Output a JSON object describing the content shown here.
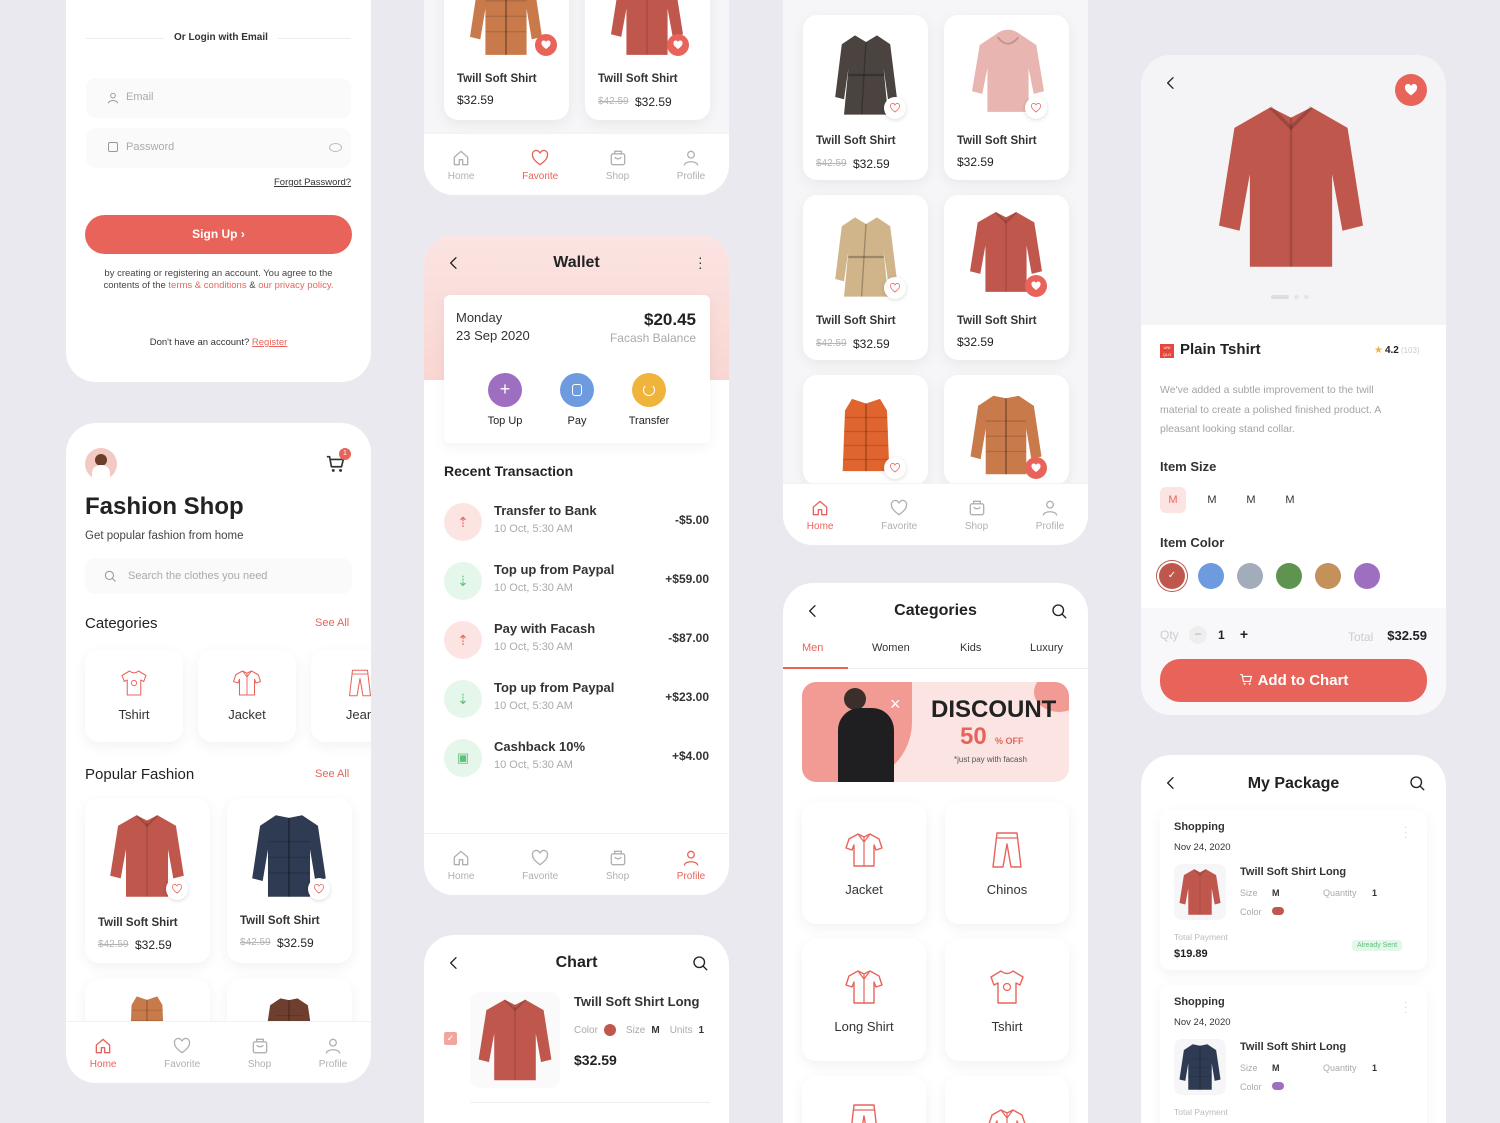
{
  "login": {
    "divider_text": "Or Login with Email",
    "email_placeholder": "Email",
    "password_placeholder": "Password",
    "forgot": "Forgot Password?",
    "signup": "Sign Up",
    "terms_1": "by creating or registering an account. You agree to the",
    "terms_2": "contents of the",
    "terms_link1": "terms & conditions",
    "terms_amp": "&",
    "terms_link2": "our privacy policy.",
    "no_account": "Don't have an account?",
    "register": "Register"
  },
  "shop": {
    "cart_count": "1",
    "title": "Fashion Shop",
    "subtitle": "Get popular fashion from home",
    "search_placeholder": "Search the clothes you need",
    "categories_title": "Categories",
    "see_all": "See All",
    "categories": [
      "Tshirt",
      "Jacket",
      "Jean"
    ],
    "popular_title": "Popular Fashion",
    "products": [
      {
        "name": "Twill Soft Shirt",
        "old": "$42.59",
        "price": "$32.59"
      },
      {
        "name": "Twill Soft Shirt",
        "old": "$42.59",
        "price": "$32.59"
      }
    ]
  },
  "nav": {
    "home": "Home",
    "favorite": "Favorite",
    "shop": "Shop",
    "profile": "Profile"
  },
  "fav": {
    "products": [
      {
        "name": "Twill Soft Shirt",
        "price": "$32.59"
      },
      {
        "name": "Twill Soft Shirt",
        "old": "$42.59",
        "price": "$32.59"
      }
    ]
  },
  "wallet": {
    "title": "Wallet",
    "day": "Monday",
    "date": "23 Sep 2020",
    "balance": "$20.45",
    "balance_label": "Facash Balance",
    "actions": [
      "Top Up",
      "Pay",
      "Transfer"
    ],
    "recent_title": "Recent Transaction",
    "transactions": [
      {
        "title": "Transfer to Bank",
        "date": "10 Oct, 5:30 AM",
        "amount": "-$5.00"
      },
      {
        "title": "Top up from Paypal",
        "date": "10 Oct, 5:30 AM",
        "amount": "+$59.00"
      },
      {
        "title": "Pay with Facash",
        "date": "10 Oct, 5:30 AM",
        "amount": "-$87.00"
      },
      {
        "title": "Top up from Paypal",
        "date": "10 Oct, 5:30 AM",
        "amount": "+$23.00"
      },
      {
        "title": "Cashback 10%",
        "date": "10 Oct, 5:30 AM",
        "amount": "+$4.00"
      }
    ]
  },
  "chart": {
    "title": "Chart",
    "item_name": "Twill Soft Shirt Long",
    "color_label": "Color",
    "size_label": "Size",
    "size": "M",
    "units_label": "Units",
    "units": "1",
    "price": "$32.59"
  },
  "grid": {
    "products": [
      {
        "name": "Twill Soft Shirt",
        "old": "$42.59",
        "price": "$32.59"
      },
      {
        "name": "Twill Soft Shirt",
        "price": "$32.59"
      },
      {
        "name": "Twill Soft Shirt",
        "old": "$42.59",
        "price": "$32.59"
      },
      {
        "name": "Twill Soft Shirt",
        "price": "$32.59"
      }
    ]
  },
  "categories_page": {
    "title": "Categories",
    "tabs": [
      "Men",
      "Women",
      "Kids",
      "Luxury"
    ],
    "banner_title": "DISCOUNT",
    "banner_pct": "50",
    "banner_off": "% OFF",
    "banner_note": "*just pay with facash",
    "items": [
      "Jacket",
      "Chinos",
      "Long Shirt",
      "Tshirt"
    ]
  },
  "detail": {
    "brand": "UNI QLO",
    "name": "Plain Tshirt",
    "rating": "4.2",
    "reviews": "(103)",
    "desc_1": "We've added a subtle improvement to the twill",
    "desc_2": "material to create a polished finished product. A",
    "desc_3": "pleasant looking stand collar.",
    "size_title": "Item Size",
    "sizes": [
      "M",
      "M",
      "M",
      "M"
    ],
    "color_title": "Item Color",
    "colors": [
      "#c0574d",
      "#6e9be0",
      "#a2acbb",
      "#5e944f",
      "#c4915a",
      "#9e6ec0"
    ],
    "qty_label": "Qty",
    "qty": "1",
    "total_label": "Total",
    "total": "$32.59",
    "add": "Add to Chart"
  },
  "package": {
    "title": "My Package",
    "orders": [
      {
        "type": "Shopping",
        "date": "Nov 24, 2020",
        "name": "Twill Soft Shirt Long",
        "size_label": "Size",
        "size": "M",
        "qty_label": "Quantity",
        "qty": "1",
        "color_label": "Color",
        "color": "#c0574d",
        "pay_label": "Total Payment",
        "pay": "$19.89",
        "status": "Already Sent"
      },
      {
        "type": "Shopping",
        "date": "Nov 24, 2020",
        "name": "Twill Soft Shirt Long",
        "size_label": "Size",
        "size": "M",
        "qty_label": "Quantity",
        "qty": "1",
        "color_label": "Color",
        "color": "#9e6ec0",
        "pay_label": "Total Payment"
      }
    ]
  }
}
